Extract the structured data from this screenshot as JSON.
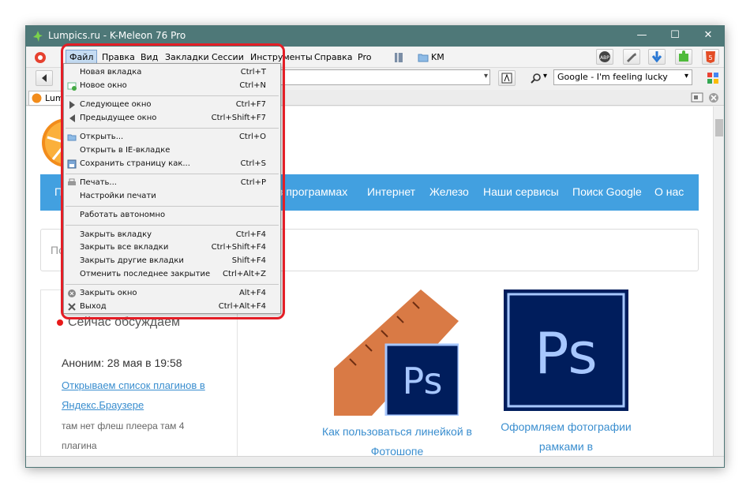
{
  "window": {
    "title": "Lumpics.ru - K-Meleon 76 Pro",
    "minimize_glyph": "—",
    "maximize_glyph": "☐",
    "close_glyph": "✕"
  },
  "menubar": {
    "items": [
      "Файл",
      "Правка",
      "Вид",
      "Закладки",
      "Сессии",
      "Инструменты",
      "Справка",
      "Pro"
    ],
    "bookmark_folder": "KM",
    "abp_label": "ABP"
  },
  "navbar": {
    "search_engine": "Google - I'm feeling lucky",
    "search_drop": "▾",
    "url_drop": "▾"
  },
  "tab": {
    "label": "Lump"
  },
  "page": {
    "nav_links": [
      "в программах",
      "Интернет",
      "Железо",
      "Наши сервисы",
      "Поиск Google",
      "О нас"
    ],
    "nav_first_partial": "П",
    "search_placeholder_partial": "По",
    "discussion_title": "Сейчас обсуждаем",
    "comment_author": "Аноним: 28 мая в 19:58",
    "comment_link": "Открываем список плагинов в Яндекс.Браузере",
    "comment_text": "там нет флеш плеера там 4 плагина",
    "article1_caption": "Как пользоваться линейкой в Фотошопе",
    "article2_caption": "Оформляем фотографии рамками в",
    "ps_label": "Ps"
  },
  "file_menu": {
    "items": [
      {
        "label": "Новая вкладка",
        "shortcut": "Ctrl+T",
        "icon": "none"
      },
      {
        "label": "Новое окно",
        "shortcut": "Ctrl+N",
        "icon": "new-window-icon"
      },
      {
        "label": "Следующее окно",
        "shortcut": "Ctrl+F7",
        "icon": "next-window-icon"
      },
      {
        "label": "Предыдущее окно",
        "shortcut": "Ctrl+Shift+F7",
        "icon": "previous-window-icon"
      },
      {
        "label": "Открыть...",
        "shortcut": "Ctrl+O",
        "icon": "open-folder-icon"
      },
      {
        "label": "Открыть в IE-вкладке",
        "shortcut": "",
        "icon": "none"
      },
      {
        "label": "Сохранить страницу как...",
        "shortcut": "Ctrl+S",
        "icon": "save-icon"
      },
      {
        "label": "Печать...",
        "shortcut": "Ctrl+P",
        "icon": "print-icon"
      },
      {
        "label": "Настройки печати",
        "shortcut": "",
        "icon": "none"
      },
      {
        "label": "Работать автономно",
        "shortcut": "",
        "icon": "none"
      },
      {
        "label": "Закрыть вкладку",
        "shortcut": "Ctrl+F4",
        "icon": "none"
      },
      {
        "label": "Закрыть все вкладки",
        "shortcut": "Ctrl+Shift+F4",
        "icon": "none"
      },
      {
        "label": "Закрыть другие вкладки",
        "shortcut": "Shift+F4",
        "icon": "none"
      },
      {
        "label": "Отменить последнее закрытие",
        "shortcut": "Ctrl+Alt+Z",
        "icon": "none"
      },
      {
        "label": "Закрыть окно",
        "shortcut": "Alt+F4",
        "icon": "close-window-icon"
      },
      {
        "label": "Выход",
        "shortcut": "Ctrl+Alt+F4",
        "icon": "exit-icon"
      }
    ]
  },
  "colors": {
    "titlebar": "#4e7878",
    "nav_strip": "#42a0e0",
    "link": "#3a8ecf",
    "highlight": "#e41e26",
    "ps_blue": "#001d5c",
    "ps_text": "#a7c7ff"
  }
}
